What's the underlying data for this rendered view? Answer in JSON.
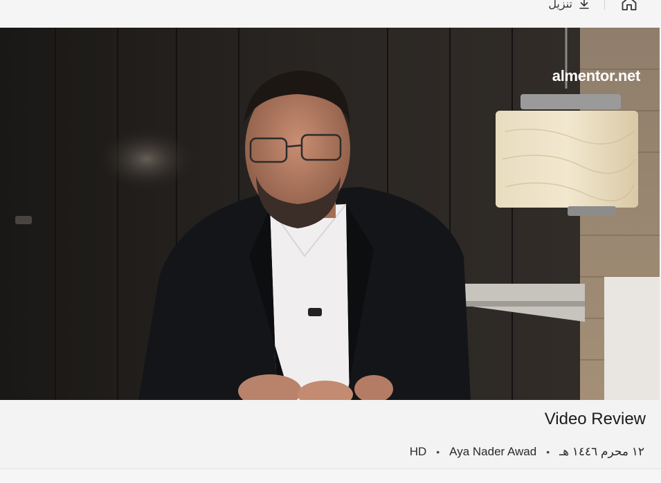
{
  "toolbar": {
    "download_label": "تنزيل",
    "download_icon": "download-icon",
    "home_icon": "home-icon"
  },
  "video": {
    "logo_text": "almentor.net"
  },
  "info": {
    "title": "Video Review",
    "date": "١٢ محرم ١٤٤٦ هـ",
    "author": "Aya Nader Awad",
    "quality": "HD",
    "separator": "•"
  }
}
